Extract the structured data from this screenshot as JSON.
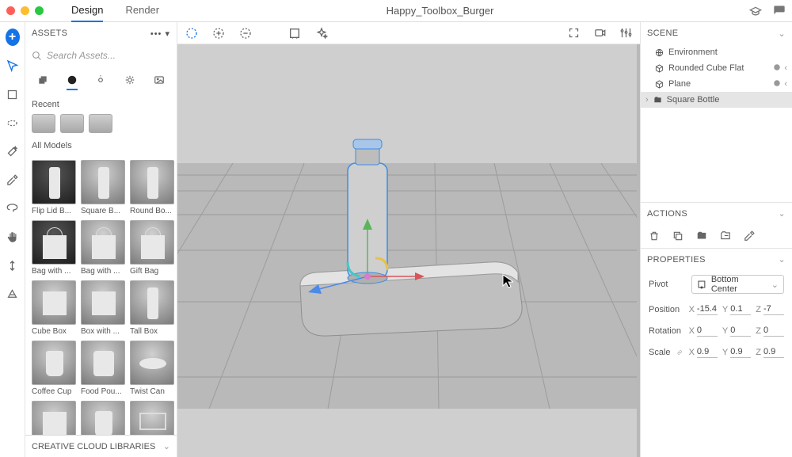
{
  "titlebar": {
    "tabs": [
      "Design",
      "Render"
    ],
    "active_tab": 0,
    "doc_title": "Happy_Toolbox_Burger"
  },
  "assets": {
    "panel_title": "ASSETS",
    "search_placeholder": "Search Assets...",
    "recent_label": "Recent",
    "all_models_label": "All Models",
    "models": [
      {
        "label": "Flip Lid B...",
        "shape": "tall",
        "dark": true
      },
      {
        "label": "Square B...",
        "shape": "tall"
      },
      {
        "label": "Round Bo...",
        "shape": "tall"
      },
      {
        "label": "Bag with ...",
        "shape": "bag",
        "dark": true
      },
      {
        "label": "Bag with ...",
        "shape": "bag"
      },
      {
        "label": "Gift Bag",
        "shape": "bag"
      },
      {
        "label": "Cube Box",
        "shape": "box"
      },
      {
        "label": "Box with ...",
        "shape": "box"
      },
      {
        "label": "Tall Box",
        "shape": "tall"
      },
      {
        "label": "Coffee Cup",
        "shape": "cup"
      },
      {
        "label": "Food Pou...",
        "shape": "pouch"
      },
      {
        "label": "Twist Can",
        "shape": "can"
      },
      {
        "label": "",
        "shape": "box"
      },
      {
        "label": "",
        "shape": "cup"
      },
      {
        "label": "",
        "shape": "laptop"
      }
    ],
    "cc_libraries": "CREATIVE CLOUD LIBRARIES"
  },
  "scene_panel": {
    "title": "SCENE",
    "items": [
      {
        "label": "Environment",
        "icon": "globe"
      },
      {
        "label": "Rounded Cube Flat",
        "icon": "cube",
        "r": true
      },
      {
        "label": "Plane",
        "icon": "cube",
        "r": true
      },
      {
        "label": "Square Bottle",
        "icon": "folder",
        "sel": true,
        "chev": true
      }
    ]
  },
  "actions_panel": {
    "title": "ACTIONS"
  },
  "props_panel": {
    "title": "PROPERTIES",
    "pivot_label": "Pivot",
    "pivot_value": "Bottom Center",
    "position_label": "Position",
    "position": {
      "x": "-15.4",
      "y": "0.1",
      "z": "-7"
    },
    "rotation_label": "Rotation",
    "rotation": {
      "x": "0",
      "y": "0",
      "z": "0"
    },
    "scale_label": "Scale",
    "scale": {
      "x": "0.9",
      "y": "0.9",
      "z": "0.9"
    }
  }
}
